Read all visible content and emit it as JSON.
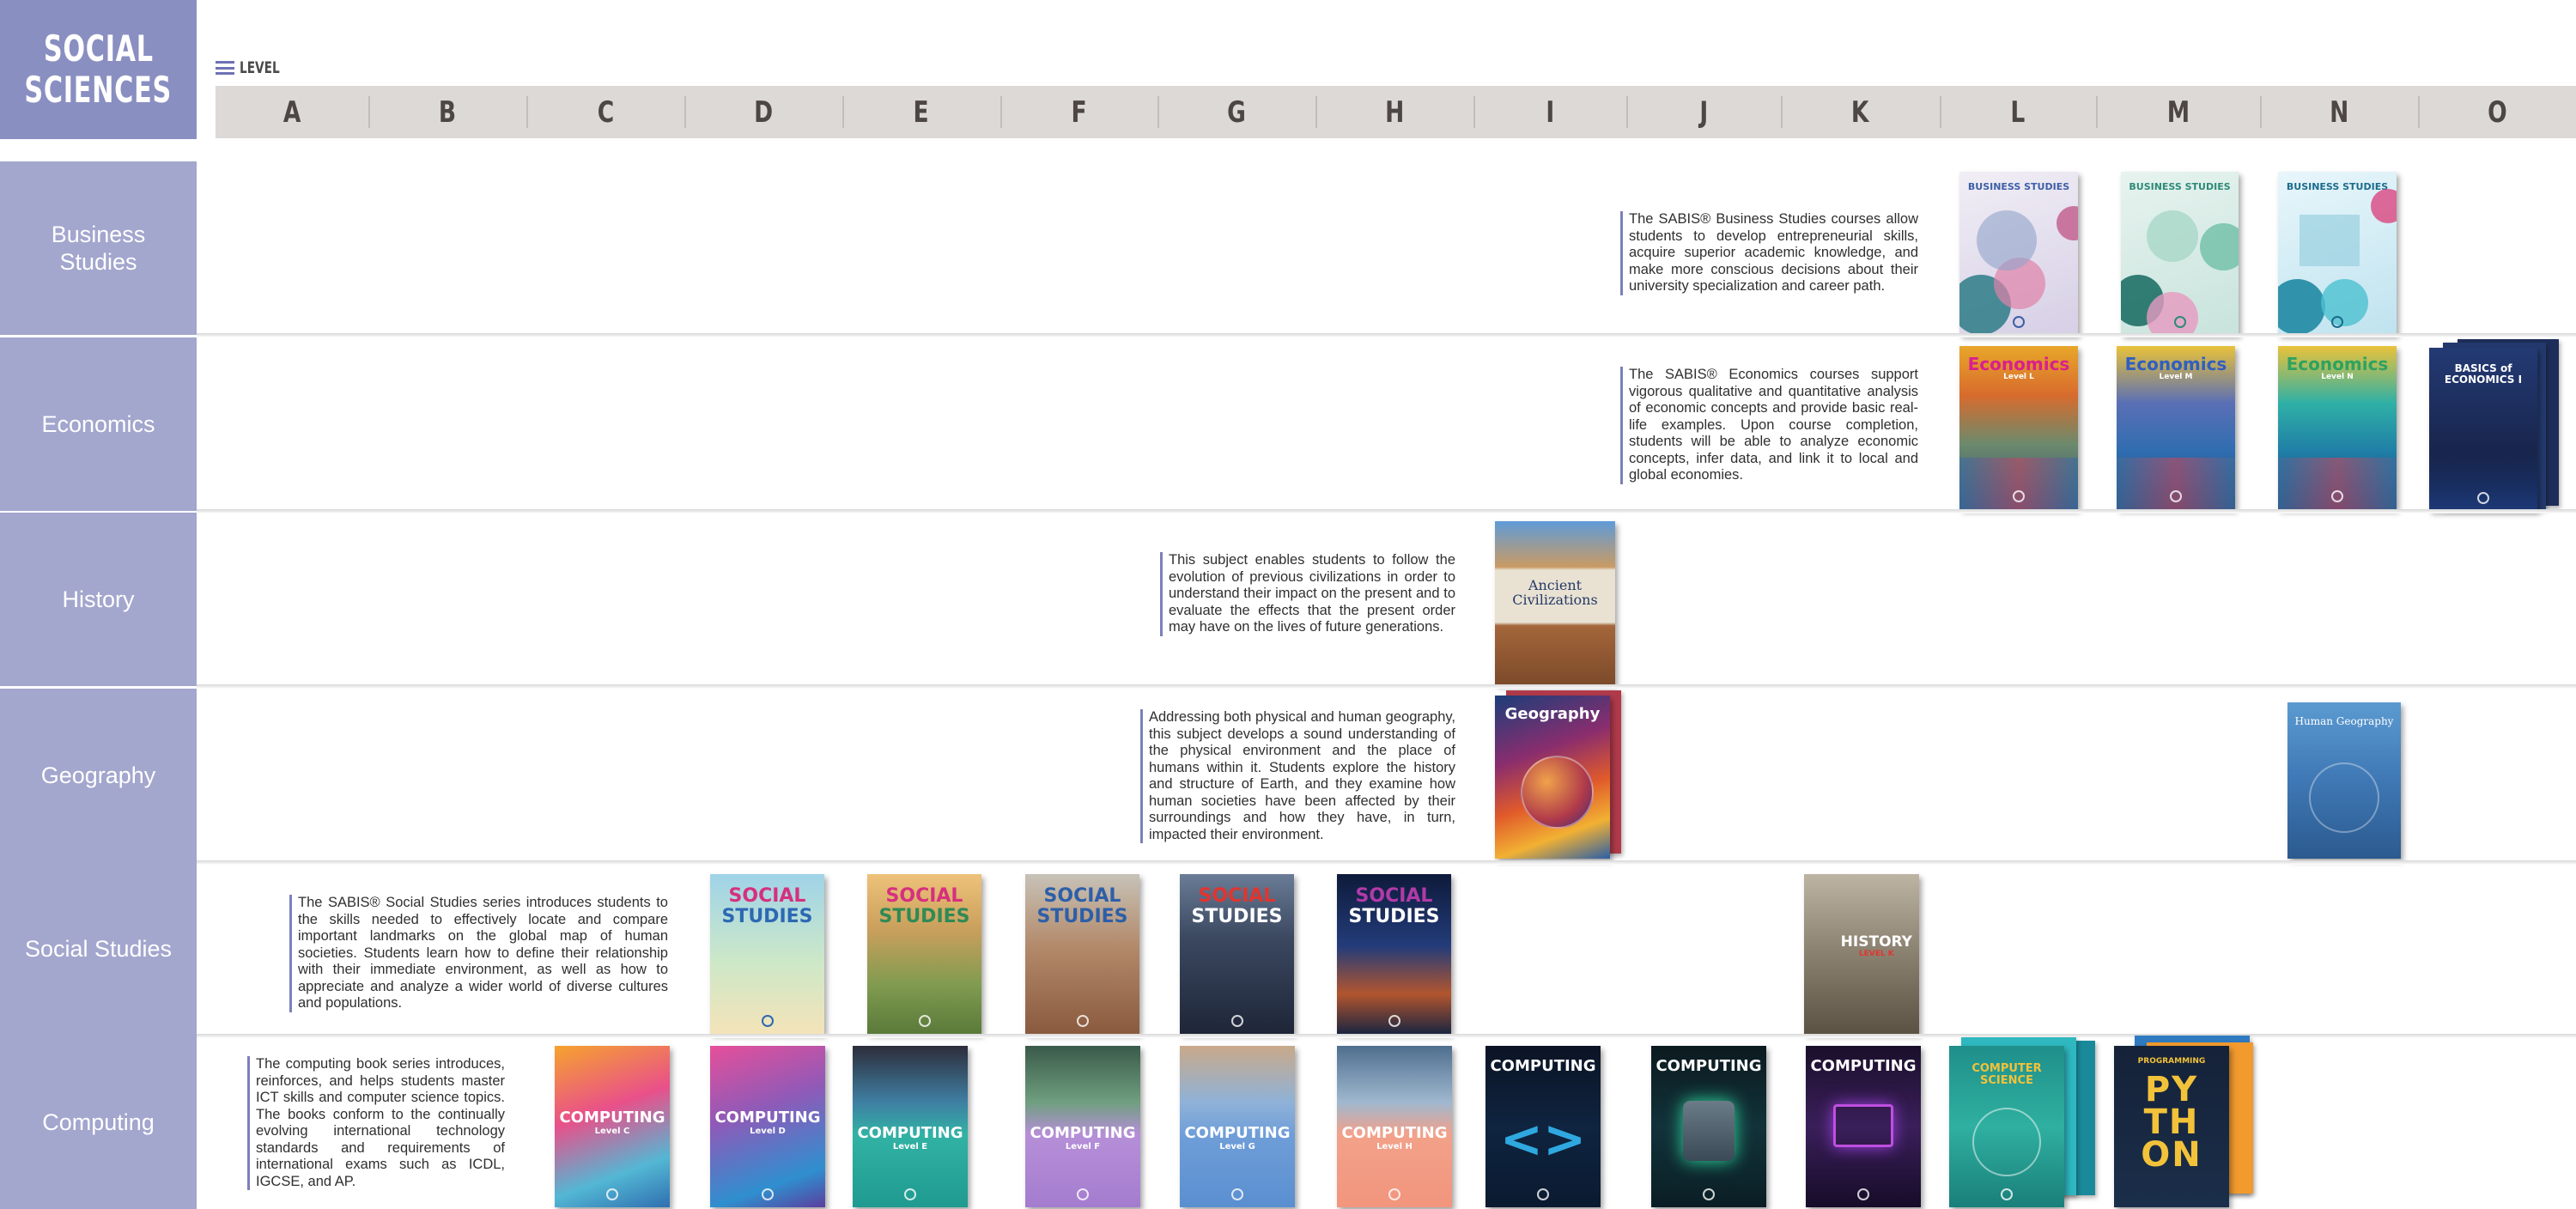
{
  "header": {
    "title_line1": "SOCIAL",
    "title_line2": "SCIENCES",
    "level_label": "LEVEL",
    "levels": [
      "A",
      "B",
      "C",
      "D",
      "E",
      "F",
      "G",
      "H",
      "I",
      "J",
      "K",
      "L",
      "M",
      "N",
      "O"
    ]
  },
  "rows": {
    "business": {
      "label": "Business Studies",
      "description": "The SABIS® Business Studies courses allow students to develop entrepreneurial skills, acquire superior academic knowledge, and make more conscious decisions about their university specialization and career path.",
      "books": [
        "BUSINESS STUDIES",
        "BUSINESS STUDIES",
        "BUSINESS STUDIES"
      ]
    },
    "economics": {
      "label": "Economics",
      "description": "The SABIS® Economics courses support vigorous qualitative and quantitative analysis of economic concepts and provide basic real-life examples. Upon course completion, students will be able to analyze economic concepts, infer data, and link it to local and global economies.",
      "books": [
        "Economics",
        "Economics",
        "Economics"
      ],
      "book_levels": [
        "Level L",
        "Level M",
        "Level N"
      ],
      "basics_title": "BASICS of ECONOMICS I"
    },
    "history": {
      "label": "History",
      "description": "This subject enables students to follow the evolution of previous civilizations in order to understand their impact on the present and to evaluate the effects that the present order may have on the lives of future generations.",
      "book_line1": "Ancient",
      "book_line2": "Civilizations"
    },
    "geography": {
      "label": "Geography",
      "description": "Addressing both physical and human geography, this subject develops a sound understanding of the physical environment and the place of humans within it. Students explore the history and structure of Earth, and they examine how human societies have been affected by their surroundings and how they have, in turn, impacted their environment.",
      "book_title": "Geography",
      "book_human": "Human Geography"
    },
    "social": {
      "label": "Social Studies",
      "description": "The SABIS® Social Studies series introduces students to the skills needed to effectively locate and compare important landmarks on the global map of human societies. Students learn how to define their relationship with their immediate environment, as well as how to appreciate and analyze a wider world of diverse cultures and populations.",
      "book_line1": "SOCIAL",
      "book_line2": "STUDIES",
      "history_title": "HISTORY",
      "history_level": "LEVEL K"
    },
    "computing": {
      "label": "Computing",
      "description": "The computing book series introduces, reinforces, and helps students master ICT skills and computer science topics. The books conform to the continually evolving international technology standards and requirements of international exams such as ICDL, IGCSE, and AP.",
      "book_title": "COMPUTING",
      "book_levels": [
        "C",
        "D",
        "E",
        "F",
        "G",
        "H"
      ],
      "level_word": "Level",
      "cs_title": "COMPUTER SCIENCE",
      "prog_label": "PROGRAMMING",
      "python_title": "PYTHON"
    }
  },
  "colors": {
    "accent": "#8a8fc1",
    "row_label": "#a3a6cd",
    "level_bar": "#dcd9d7"
  }
}
